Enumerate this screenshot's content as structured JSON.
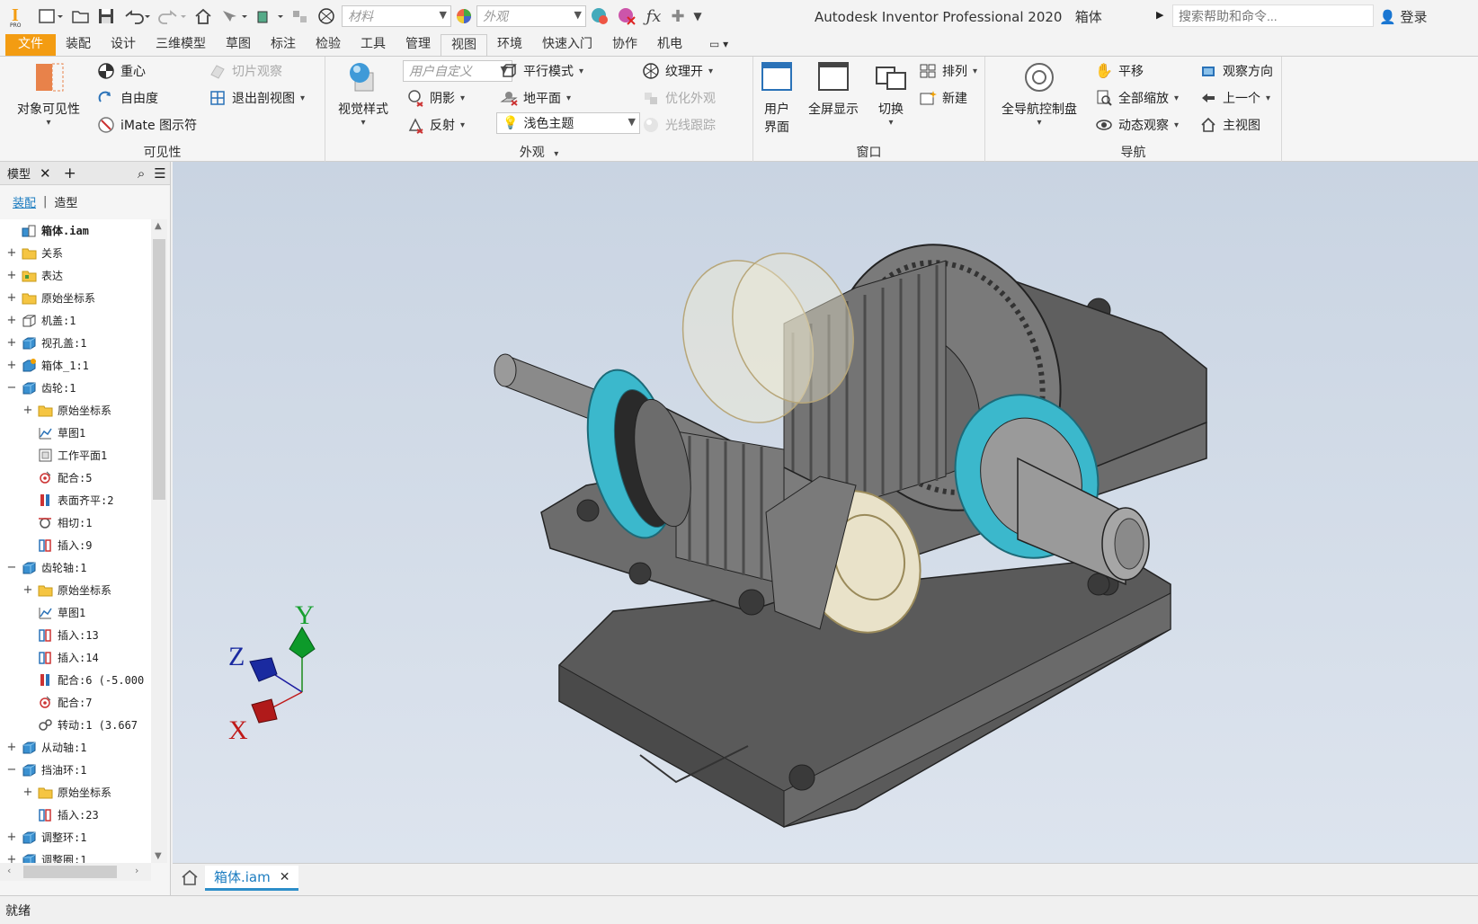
{
  "titlebar": {
    "material_placeholder": "材料",
    "appearance_placeholder": "外观",
    "app_title": "Autodesk Inventor Professional 2020",
    "doc_name": "箱体",
    "search_placeholder": "搜索帮助和命令...",
    "login": "登录"
  },
  "tabs": [
    "文件",
    "装配",
    "设计",
    "三维模型",
    "草图",
    "标注",
    "检验",
    "工具",
    "管理",
    "视图",
    "环境",
    "快速入门",
    "协作",
    "机电"
  ],
  "active_tab": "视图",
  "ribbon": {
    "visibility": {
      "title": "可见性",
      "object_visibility": "对象可见性",
      "center_of_gravity": "重心",
      "dof": "自由度",
      "imate": "iMate 图示符",
      "slice": "切片观察",
      "exit_section": "退出剖视图"
    },
    "appearance": {
      "title": "外观",
      "visual_style": "视觉样式",
      "user_defined": "用户自定义",
      "shadows": "阴影",
      "reflection": "反射",
      "parallel_mode": "平行模式",
      "ground_plane": "地平面",
      "light_theme": "浅色主题",
      "texture_on": "纹理开",
      "optimize_appearance": "优化外观",
      "ray_tracing": "光线跟踪"
    },
    "window": {
      "title": "窗口",
      "user_interface_1": "用户",
      "user_interface_2": "界面",
      "fullscreen": "全屏显示",
      "switch": "切换",
      "arrange": "排列",
      "new": "新建"
    },
    "navigate": {
      "title": "导航",
      "full_nav_wheel": "全导航控制盘",
      "pan": "平移",
      "zoom_all": "全部缩放",
      "orbit": "动态观察",
      "look_at": "观察方向",
      "previous": "上一个",
      "home": "主视图"
    }
  },
  "browser": {
    "tab_model": "模型",
    "subtab_assembly": "装配",
    "subtab_modeling": "造型",
    "items": [
      {
        "label": "箱体.iam",
        "exp": "",
        "indent": 0,
        "icon": "assembly-icon",
        "bold": true
      },
      {
        "label": "关系",
        "exp": "+",
        "indent": 0,
        "icon": "folder-icon"
      },
      {
        "label": "表达",
        "exp": "+",
        "indent": 0,
        "icon": "representations-icon"
      },
      {
        "label": "原始坐标系",
        "exp": "+",
        "indent": 0,
        "icon": "folder-icon"
      },
      {
        "label": "机盖:1",
        "exp": "+",
        "indent": 0,
        "icon": "part-wire-icon"
      },
      {
        "label": "视孔盖:1",
        "exp": "+",
        "indent": 0,
        "icon": "part-icon"
      },
      {
        "label": "箱体_1:1",
        "exp": "+",
        "indent": 0,
        "icon": "part-edit-icon"
      },
      {
        "label": "齿轮:1",
        "exp": "−",
        "indent": 0,
        "icon": "part-icon"
      },
      {
        "label": "原始坐标系",
        "exp": "+",
        "indent": 1,
        "icon": "folder-icon"
      },
      {
        "label": "草图1",
        "exp": "",
        "indent": 1,
        "icon": "sketch-icon"
      },
      {
        "label": "工作平面1",
        "exp": "",
        "indent": 1,
        "icon": "workplane-icon"
      },
      {
        "label": "配合:5",
        "exp": "",
        "indent": 1,
        "icon": "mate-icon"
      },
      {
        "label": "表面齐平:2",
        "exp": "",
        "indent": 1,
        "icon": "flush-icon"
      },
      {
        "label": "相切:1",
        "exp": "",
        "indent": 1,
        "icon": "tangent-icon"
      },
      {
        "label": "插入:9",
        "exp": "",
        "indent": 1,
        "icon": "insert-icon"
      },
      {
        "label": "齿轮轴:1",
        "exp": "−",
        "indent": 0,
        "icon": "part-icon"
      },
      {
        "label": "原始坐标系",
        "exp": "+",
        "indent": 1,
        "icon": "folder-icon"
      },
      {
        "label": "草图1",
        "exp": "",
        "indent": 1,
        "icon": "sketch-icon"
      },
      {
        "label": "插入:13",
        "exp": "",
        "indent": 1,
        "icon": "insert-icon"
      },
      {
        "label": "插入:14",
        "exp": "",
        "indent": 1,
        "icon": "insert-icon"
      },
      {
        "label": "配合:6 (-5.000",
        "exp": "",
        "indent": 1,
        "icon": "flush-icon"
      },
      {
        "label": "配合:7",
        "exp": "",
        "indent": 1,
        "icon": "mate-icon"
      },
      {
        "label": "转动:1 (3.667",
        "exp": "",
        "indent": 1,
        "icon": "rotation-icon"
      },
      {
        "label": "从动轴:1",
        "exp": "+",
        "indent": 0,
        "icon": "part-icon"
      },
      {
        "label": "挡油环:1",
        "exp": "−",
        "indent": 0,
        "icon": "part-icon"
      },
      {
        "label": "原始坐标系",
        "exp": "+",
        "indent": 1,
        "icon": "folder-icon"
      },
      {
        "label": "插入:23",
        "exp": "",
        "indent": 1,
        "icon": "insert-icon"
      },
      {
        "label": "调整环:1",
        "exp": "+",
        "indent": 0,
        "icon": "part-icon"
      },
      {
        "label": "调整圈:1",
        "exp": "+",
        "indent": 0,
        "icon": "part-icon"
      }
    ]
  },
  "viewcube_axes": {
    "x": "X",
    "y": "Y",
    "z": "Z"
  },
  "doc_tab": "箱体.iam",
  "status": "就绪",
  "colors": {
    "accent": "#f39c12",
    "link": "#1b7cc0",
    "cyan_part": "#3bb8cc"
  }
}
